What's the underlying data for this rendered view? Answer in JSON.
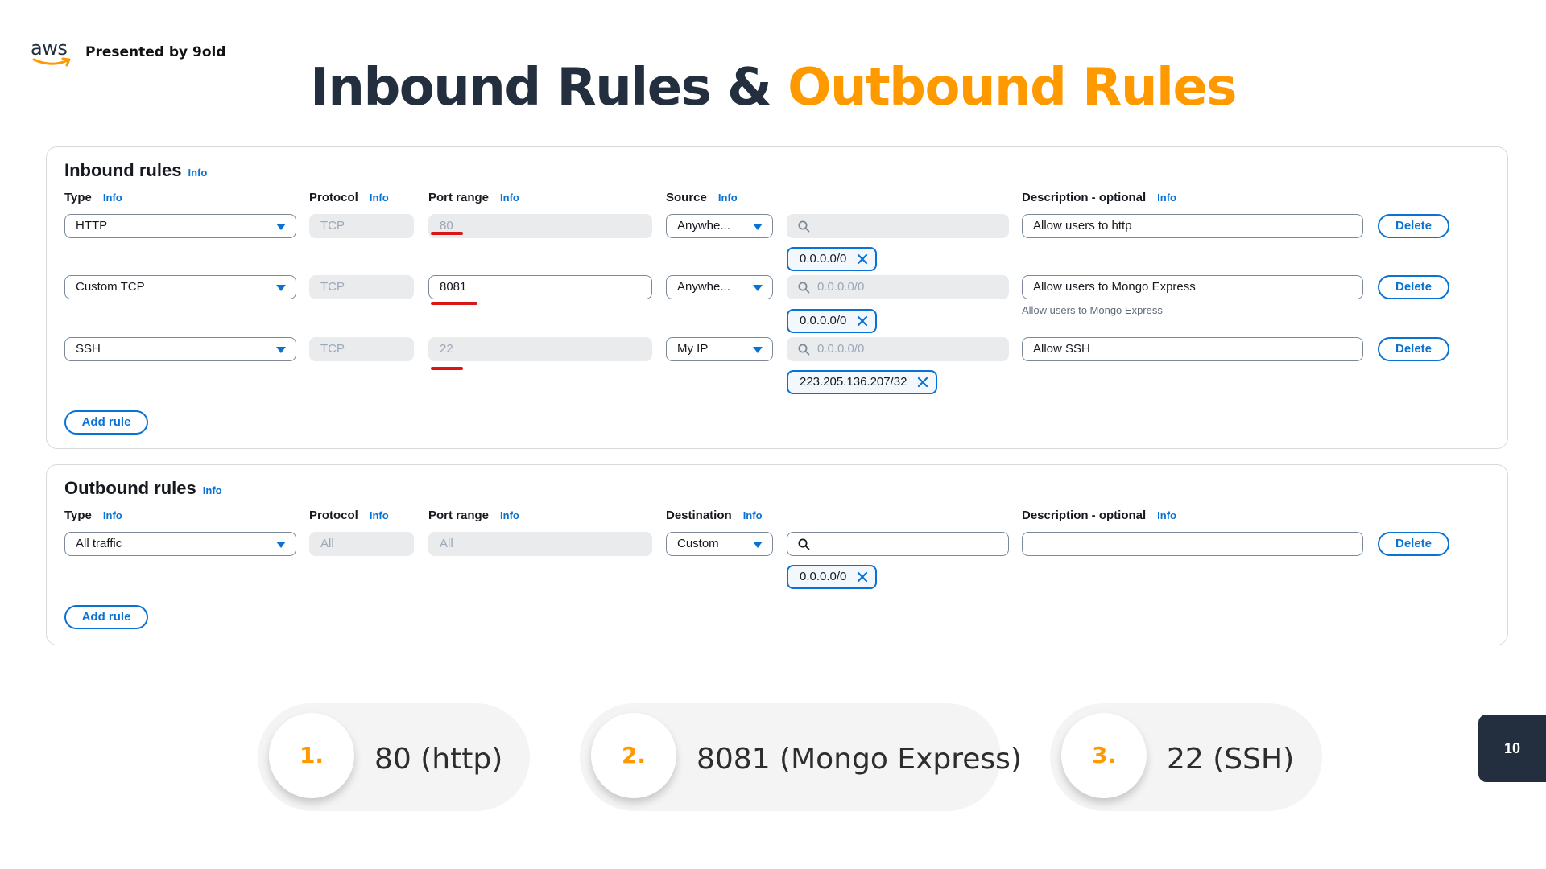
{
  "header": {
    "logo_text": "aws",
    "presented_by": "Presented by 9old",
    "title_main": "Inbound Rules &",
    "title_accent": "Outbound Rules",
    "accent_color": "#ff9900"
  },
  "inbound": {
    "title": "Inbound rules",
    "info": "Info",
    "columns": {
      "type": "Type",
      "protocol": "Protocol",
      "port_range": "Port range",
      "source": "Source",
      "description": "Description - optional"
    },
    "rows": [
      {
        "type": "HTTP",
        "protocol": "TCP",
        "port": "80",
        "source": "Anywhe...",
        "search": "",
        "token": "0.0.0.0/0",
        "description": "Allow users to http",
        "delete": "Delete"
      },
      {
        "type": "Custom TCP",
        "protocol": "TCP",
        "port": "8081",
        "source": "Anywhe...",
        "search": "0.0.0.0/0",
        "token": "0.0.0.0/0",
        "description": "Allow users to Mongo Express",
        "hint": "Allow users to Mongo Express",
        "delete": "Delete"
      },
      {
        "type": "SSH",
        "protocol": "TCP",
        "port": "22",
        "source": "My IP",
        "search": "0.0.0.0/0",
        "token": "223.205.136.207/32",
        "description": "Allow SSH",
        "delete": "Delete"
      }
    ],
    "add_rule": "Add rule"
  },
  "outbound": {
    "title": "Outbound rules",
    "info": "Info",
    "columns": {
      "type": "Type",
      "protocol": "Protocol",
      "port_range": "Port range",
      "destination": "Destination",
      "description": "Description - optional"
    },
    "rows": [
      {
        "type": "All traffic",
        "protocol": "All",
        "port": "All",
        "destination": "Custom",
        "search": "",
        "token": "0.0.0.0/0",
        "description": "",
        "delete": "Delete"
      }
    ],
    "add_rule": "Add rule"
  },
  "callouts": [
    {
      "number": "1.",
      "text": "80 (http)"
    },
    {
      "number": "2.",
      "text": "8081 (Mongo Express)"
    },
    {
      "number": "3.",
      "text": "22 (SSH)"
    }
  ],
  "page_number": "10",
  "icons": {
    "dropdown": "caret-down-icon",
    "search": "search-icon",
    "remove": "close-icon"
  }
}
